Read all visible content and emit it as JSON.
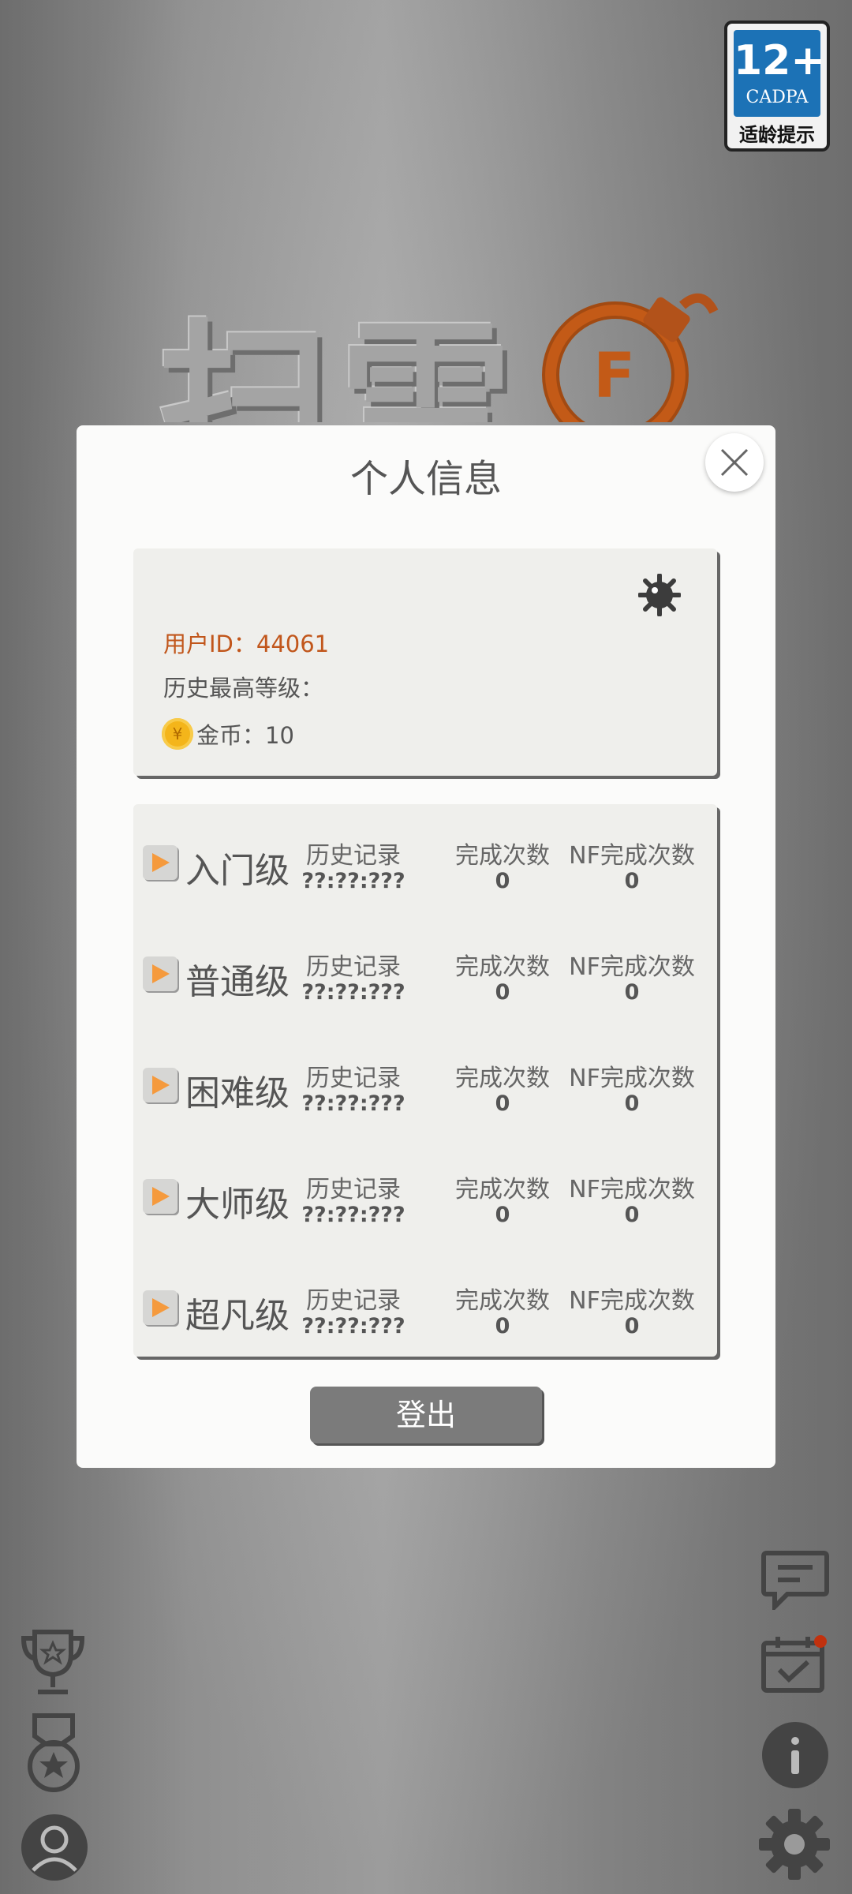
{
  "age_badge": {
    "rating": "12+",
    "org": "CADPA",
    "tip": "适龄提示"
  },
  "logo": {
    "text": "扫雷"
  },
  "modal": {
    "title": "个人信息",
    "user_id": "用户ID：44061",
    "max_level": "历史最高等级：",
    "coins": "金币：10",
    "levels": [
      {
        "name": "入门级",
        "history_label": "历史记录",
        "history": "??:??:???",
        "completions_label": "完成次数",
        "completions": "0",
        "nf_label": "NF完成次数",
        "nf": "0"
      },
      {
        "name": "普通级",
        "history_label": "历史记录",
        "history": "??:??:???",
        "completions_label": "完成次数",
        "completions": "0",
        "nf_label": "NF完成次数",
        "nf": "0"
      },
      {
        "name": "困难级",
        "history_label": "历史记录",
        "history": "??:??:???",
        "completions_label": "完成次数",
        "completions": "0",
        "nf_label": "NF完成次数",
        "nf": "0"
      },
      {
        "name": "大师级",
        "history_label": "历史记录",
        "history": "??:??:???",
        "completions_label": "完成次数",
        "completions": "0",
        "nf_label": "NF完成次数",
        "nf": "0"
      },
      {
        "name": "超凡级",
        "history_label": "历史记录",
        "history": "??:??:???",
        "completions_label": "完成次数",
        "completions": "0",
        "nf_label": "NF完成次数",
        "nf": "0"
      }
    ],
    "logout": "登出"
  },
  "icons": [
    "close-icon",
    "settings-icon",
    "coin-icon",
    "play-icon",
    "trophy-icon",
    "medal-icon",
    "profile-icon",
    "chat-icon",
    "calendar-check-icon",
    "info-icon",
    "gear-icon"
  ],
  "colors": {
    "accent_orange": "#c1561b",
    "notification_dot": "#c1310e",
    "logout_button": "#7b7b7b"
  }
}
